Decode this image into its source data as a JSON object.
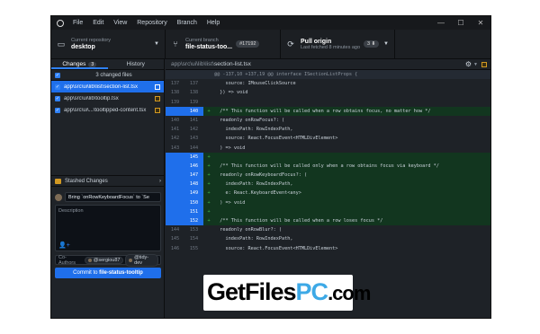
{
  "titlebar": {
    "menu": [
      "File",
      "Edit",
      "View",
      "Repository",
      "Branch",
      "Help"
    ],
    "controls": [
      "—",
      "☐",
      "✕"
    ]
  },
  "toolbar": {
    "repo_label": "Current repository",
    "repo_value": "desktop",
    "branch_label": "Current branch",
    "branch_value": "file-status-too...",
    "branch_pr": "#17192",
    "fetch_label": "Pull origin",
    "fetch_value": "Last fetched 8 minutes ago",
    "fetch_count": "3 ⬇"
  },
  "sidebar": {
    "tab_changes": "Changes",
    "tab_changes_count": "3",
    "tab_history": "History",
    "changed_files_label": "3 changed files",
    "files": [
      {
        "path": "app\\src\\ui\\lib\\list\\section-list.tsx",
        "selected": true
      },
      {
        "path": "app\\src\\ui\\lib\\tooltip.tsx",
        "selected": false
      },
      {
        "path": "app\\src\\ui\\...\\tooltipped-content.tsx",
        "selected": false
      }
    ],
    "stash_label": "Stashed Changes",
    "summary_value": "Bring `onRowKeyboardFocus` to `Se",
    "description_placeholder": "Description",
    "coauthors_label": "Co-Authors",
    "coauthors": [
      "@sergiou87",
      "@tidy-dev"
    ],
    "commit_prefix": "Commit to ",
    "commit_branch": "file-status-tooltip"
  },
  "diff": {
    "path_prefix": "app\\src\\ui\\lib\\list\\",
    "file_name": "section-list.tsx",
    "rows": [
      {
        "type": "hunk",
        "old": "",
        "new": "",
        "code": "@@ -137,10 +137,19 @@ interface ISectionListProps {"
      },
      {
        "type": "ctx",
        "old": "137",
        "new": "137",
        "code": "    source: IMouseClickSource"
      },
      {
        "type": "ctx",
        "old": "138",
        "new": "138",
        "code": "  }) => void"
      },
      {
        "type": "ctx",
        "old": "139",
        "new": "139",
        "code": ""
      },
      {
        "type": "add",
        "old": "",
        "new": "140",
        "code": "  /** This function will be called when a row obtains focus, no matter how */"
      },
      {
        "type": "ctx",
        "old": "140",
        "new": "141",
        "code": "  readonly onRowFocus?: ("
      },
      {
        "type": "ctx",
        "old": "141",
        "new": "142",
        "code": "    indexPath: RowIndexPath,"
      },
      {
        "type": "ctx",
        "old": "142",
        "new": "143",
        "code": "    source: React.FocusEvent<HTMLDivElement>"
      },
      {
        "type": "ctx",
        "old": "143",
        "new": "144",
        "code": "  ) => void"
      },
      {
        "type": "add",
        "old": "",
        "new": "145",
        "code": ""
      },
      {
        "type": "add",
        "old": "",
        "new": "146",
        "code": "  /** This function will be called only when a row obtains focus via keyboard */"
      },
      {
        "type": "add",
        "old": "",
        "new": "147",
        "code": "  readonly onRowKeyboardFocus?: ("
      },
      {
        "type": "add",
        "old": "",
        "new": "148",
        "code": "    indexPath: RowIndexPath,"
      },
      {
        "type": "add",
        "old": "",
        "new": "149",
        "code": "    e: React.KeyboardEvent<any>"
      },
      {
        "type": "add",
        "old": "",
        "new": "150",
        "code": "  ) => void"
      },
      {
        "type": "add",
        "old": "",
        "new": "151",
        "code": ""
      },
      {
        "type": "add",
        "old": "",
        "new": "152",
        "code": "  /** This function will be called when a row loses focus */"
      },
      {
        "type": "ctx",
        "old": "144",
        "new": "153",
        "code": "  readonly onRowBlur?: ("
      },
      {
        "type": "ctx",
        "old": "145",
        "new": "154",
        "code": "    indexPath: RowIndexPath,"
      },
      {
        "type": "ctx",
        "old": "146",
        "new": "155",
        "code": "    source: React.FocusEvent<HTMLDivElement>"
      },
      {
        "type": "ctx",
        "old": "",
        "new": "",
        "code": ""
      }
    ]
  },
  "watermark": {
    "part1": "GetFiles",
    "part2": "PC",
    "part3": ".com"
  },
  "colors": {
    "accent": "#1f6feb",
    "added_bg": "#12361f",
    "app_bg": "#1e2227"
  }
}
